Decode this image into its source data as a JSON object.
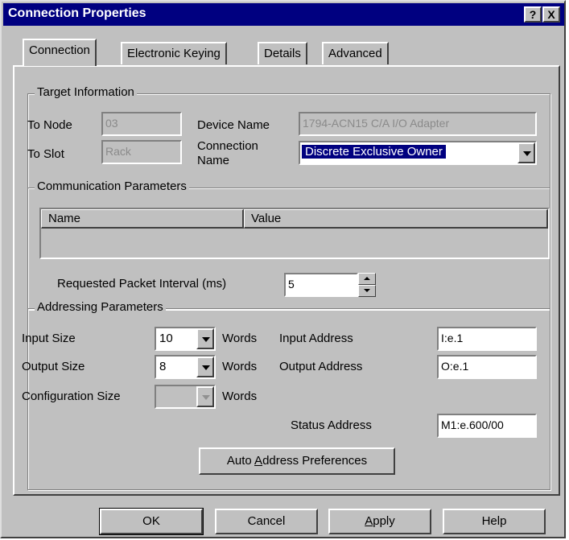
{
  "window": {
    "title": "Connection Properties",
    "help_button": "?",
    "close_button": "X"
  },
  "tabs": [
    {
      "label": "Connection",
      "active": true
    },
    {
      "label": "Electronic Keying",
      "active": false
    },
    {
      "label": "Details",
      "active": false
    },
    {
      "label": "Advanced",
      "active": false
    }
  ],
  "target_info": {
    "legend": "Target Information",
    "to_node_label": "To Node",
    "to_node_value": "03",
    "to_slot_label": "To Slot",
    "to_slot_value": "Rack",
    "device_name_label": "Device Name",
    "device_name_value": "1794-ACN15 C/A I/O Adapter",
    "connection_name_label_1": "Connection",
    "connection_name_label_2": "Name",
    "connection_name_value": "Discrete Exclusive Owner"
  },
  "comm_params": {
    "legend": "Communication Parameters",
    "col_name": "Name",
    "col_value": "Value",
    "rpi_label": "Requested Packet Interval (ms)",
    "rpi_value": "5"
  },
  "addressing": {
    "legend": "Addressing Parameters",
    "input_size_label": "Input Size",
    "input_size_value": "10",
    "output_size_label": "Output Size",
    "output_size_value": "8",
    "config_size_label": "Configuration Size",
    "config_size_value": "",
    "words_label": "Words",
    "input_address_label": "Input Address",
    "input_address_value": "I:e.1",
    "output_address_label": "Output Address",
    "output_address_value": "O:e.1",
    "status_address_label": "Status Address",
    "status_address_value": "M1:e.600/00",
    "auto_address_prefix": "Auto ",
    "auto_address_accel": "A",
    "auto_address_rest": "ddress Preferences"
  },
  "buttons": {
    "ok": "OK",
    "cancel": "Cancel",
    "apply_accel": "A",
    "apply_rest": "pply",
    "help": "Help"
  },
  "colors": {
    "titlebar": "#000080",
    "face": "#c0c0c0",
    "highlight": "#ffffff",
    "shadow": "#808080"
  }
}
